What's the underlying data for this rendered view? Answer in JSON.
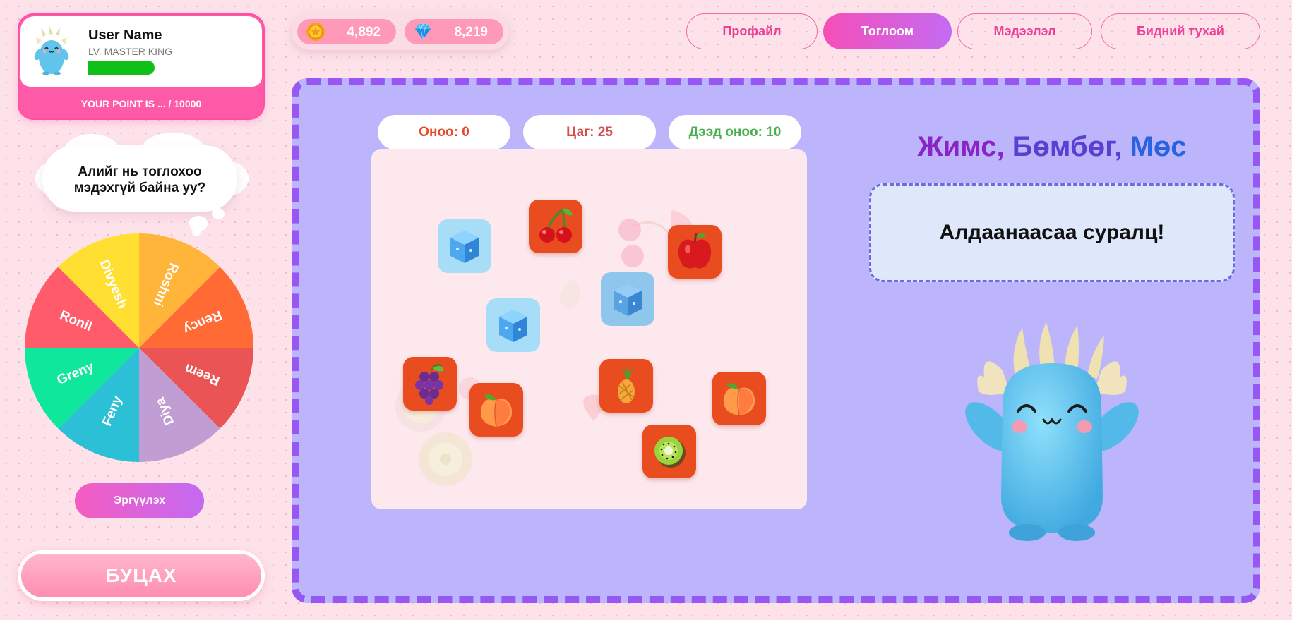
{
  "profile": {
    "name": "User Name",
    "level": "LV. MASTER KING",
    "points_text": "YOUR POINT IS ... / 10000",
    "progress": 0.3
  },
  "bubble": {
    "line1": "Алийг нь тоглохоо",
    "line2": "мэдэхгүй байна уу?"
  },
  "wheel": {
    "segments": [
      {
        "label": "Roshni",
        "color": "#ffb43a"
      },
      {
        "label": "Rency",
        "color": "#ff6a35"
      },
      {
        "label": "Reem",
        "color": "#ea5455"
      },
      {
        "label": "Diya",
        "color": "#c09dd2"
      },
      {
        "label": "Feny",
        "color": "#2bc0d5"
      },
      {
        "label": "Greny",
        "color": "#0fe79c"
      },
      {
        "label": "Ronil",
        "color": "#ff5b6b"
      },
      {
        "label": "Divyesh",
        "color": "#ffe032"
      }
    ],
    "spin_label": "Эргүүлэх"
  },
  "back_label": "БУЦАХ",
  "currency": {
    "coins": "4,892",
    "gems": "8,219"
  },
  "nav": [
    {
      "label": "Профайл",
      "active": false
    },
    {
      "label": "Тоглоом",
      "active": true
    },
    {
      "label": "Мэдээлэл",
      "active": false
    },
    {
      "label": "Бидний тухай",
      "active": false
    }
  ],
  "stats": {
    "score": "Оноо: 0",
    "time": "Цаг: 25",
    "best": "Дээд оноо: 10"
  },
  "game": {
    "title_part1": "Жимс,",
    "title_part2": "Бөмбөг,",
    "title_part3": "Мөс",
    "message": "Алдаанаасаа суралц!"
  },
  "items": [
    {
      "kind": "ice-cube",
      "icon": "ice-cube-icon"
    },
    {
      "kind": "cherry",
      "icon": "cherry-icon"
    },
    {
      "kind": "apple",
      "icon": "apple-icon"
    },
    {
      "kind": "ice-cube",
      "icon": "ice-cube-icon"
    },
    {
      "kind": "ice-cube",
      "icon": "ice-cube-icon"
    },
    {
      "kind": "grapes",
      "icon": "grapes-icon"
    },
    {
      "kind": "peach",
      "icon": "peach-icon"
    },
    {
      "kind": "pineapple",
      "icon": "pineapple-icon"
    },
    {
      "kind": "peach",
      "icon": "peach-icon"
    },
    {
      "kind": "kiwi",
      "icon": "kiwi-icon"
    }
  ],
  "colors": {
    "accent_pink": "#ff5aa8",
    "board_bg": "#bcb5fb",
    "board_border": "#9657f2",
    "score_color": "#e5492a",
    "time_color": "#d94c4c",
    "best_color": "#4caf50"
  }
}
